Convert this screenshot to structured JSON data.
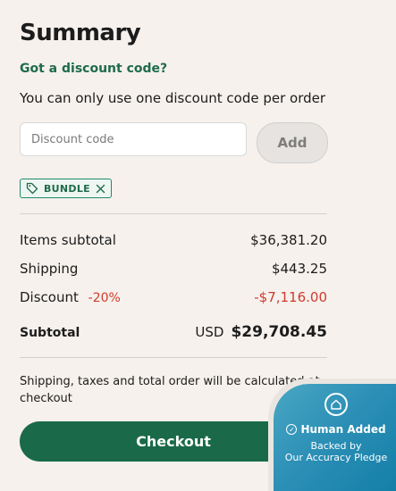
{
  "summary": {
    "title": "Summary",
    "discount_link": "Got a discount code?",
    "discount_note": "You can only use one discount code per order",
    "discount_placeholder": "Discount code",
    "add_label": "Add",
    "applied_code": "BUNDLE",
    "items_subtotal_label": "Items subtotal",
    "items_subtotal_value": "$36,381.20",
    "shipping_label": "Shipping",
    "shipping_value": "$443.25",
    "discount_label": "Discount",
    "discount_percent": "-20%",
    "discount_value": "-$7,116.00",
    "subtotal_label": "Subtotal",
    "subtotal_currency": "USD",
    "subtotal_value": "$29,708.45",
    "footer_note": "Shipping, taxes and total order will be calculated at checkout",
    "checkout_label": "Checkout"
  },
  "badge": {
    "line1": "Human Added",
    "line2": "Backed by",
    "line3": "Our Accuracy Pledge"
  },
  "colors": {
    "brand_green": "#1a6a49",
    "discount_red": "#d03a2c",
    "background": "#f6f1ed"
  }
}
